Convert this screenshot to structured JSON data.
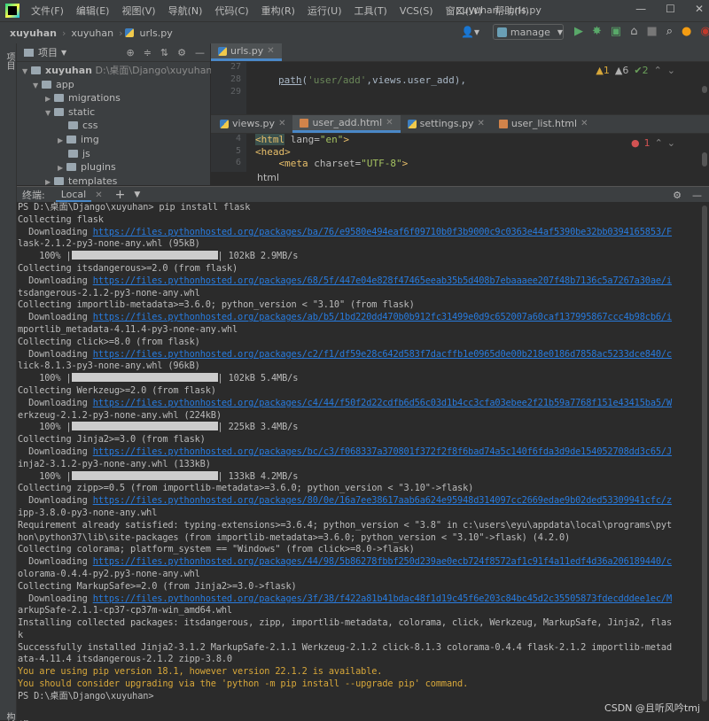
{
  "menubar": {
    "items": [
      "文件(F)",
      "编辑(E)",
      "视图(V)",
      "导航(N)",
      "代码(C)",
      "重构(R)",
      "运行(U)",
      "工具(T)",
      "VCS(S)",
      "窗口(W)",
      "帮助(H)"
    ],
    "window_title": "xuyuhan - urls.py",
    "window_buttons": [
      "—",
      "☐",
      "✕"
    ]
  },
  "navbar": {
    "crumbs": [
      "xuyuhan",
      "xuyuhan",
      "urls.py"
    ],
    "run_config": "manage"
  },
  "left_strip": {
    "top_label": "项目",
    "bottom_label": "结构"
  },
  "project": {
    "header": "项目",
    "tree": [
      {
        "label": "xuyuhan",
        "path": "D:\\桌面\\Django\\xuyuhan",
        "level": 1,
        "open": true
      },
      {
        "label": "app",
        "level": 2,
        "open": true
      },
      {
        "label": "migrations",
        "level": 3,
        "open": false
      },
      {
        "label": "static",
        "level": 3,
        "open": true
      },
      {
        "label": "css",
        "level": 4,
        "open": false
      },
      {
        "label": "img",
        "level": 4,
        "open": false
      },
      {
        "label": "js",
        "level": 4,
        "open": false
      },
      {
        "label": "plugins",
        "level": 4,
        "open": false
      },
      {
        "label": "templates",
        "level": 3,
        "open": false
      }
    ]
  },
  "editor1": {
    "tab": "urls.py",
    "line_numbers": [
      "27",
      "28",
      "29"
    ],
    "code_path": "path",
    "code_str": "'user/add'",
    "code_rest": ",views.user_add),",
    "inspections": {
      "warnings": "1",
      "weak": "6",
      "ok": "2"
    }
  },
  "editor2": {
    "tabs": [
      "views.py",
      "user_add.html",
      "settings.py",
      "user_list.html"
    ],
    "active_tab": 1,
    "line_numbers": [
      "4",
      "5",
      "6"
    ],
    "line1_tag": "<html",
    "line1_attr": " lang=",
    "line1_val": "\"en\"",
    "line1_end": ">",
    "line2": "<head>",
    "line3_tag": "<meta",
    "line3_attr": " charset=",
    "line3_val": "\"UTF-8\"",
    "line3_end": ">",
    "breadcrumb": "html",
    "errors": "1"
  },
  "terminal": {
    "label": "终端:",
    "tab": "Local",
    "lines": [
      {
        "t": "PS D:\\桌面\\Django\\xuyuhan> pip install flask"
      },
      {
        "t": "Collecting flask"
      },
      {
        "t": "  Downloading ",
        "l": "https://files.pythonhosted.org/packages/ba/76/e9580e494eaf6f09710b0f3b9000c9c0363e44af5390be32bb0394165853/F"
      },
      {
        "t": "lask-2.1.2-py3-none-any.whl (95kB)"
      },
      {
        "t": "    100% |",
        "bar": 165,
        "a": "| 102kB 2.9MB/s"
      },
      {
        "t": "Collecting itsdangerous>=2.0 (from flask)"
      },
      {
        "t": "  Downloading ",
        "l": "https://files.pythonhosted.org/packages/68/5f/447e04e828f47465eeab35b5d408b7ebaaaee207f48b7136c5a7267a30ae/i"
      },
      {
        "t": "tsdangerous-2.1.2-py3-none-any.whl"
      },
      {
        "t": "Collecting importlib-metadata>=3.6.0; python_version < \"3.10\" (from flask)"
      },
      {
        "t": "  Downloading ",
        "l": "https://files.pythonhosted.org/packages/ab/b5/1bd220dd470b0b912fc31499e0d9c652007a60caf137995867ccc4b98cb6/i"
      },
      {
        "t": "mportlib_metadata-4.11.4-py3-none-any.whl"
      },
      {
        "t": "Collecting click>=8.0 (from flask)"
      },
      {
        "t": "  Downloading ",
        "l": "https://files.pythonhosted.org/packages/c2/f1/df59e28c642d583f7dacffb1e0965d0e00b218e0186d7858ac5233dce840/c"
      },
      {
        "t": "lick-8.1.3-py3-none-any.whl (96kB)"
      },
      {
        "t": "    100% |",
        "bar": 165,
        "a": "| 102kB 5.4MB/s"
      },
      {
        "t": "Collecting Werkzeug>=2.0 (from flask)"
      },
      {
        "t": "  Downloading ",
        "l": "https://files.pythonhosted.org/packages/c4/44/f50f2d22cdfb6d56c03d1b4cc3cfa03ebee2f21b59a7768f151e43415ba5/W"
      },
      {
        "t": "erkzeug-2.1.2-py3-none-any.whl (224kB)"
      },
      {
        "t": "    100% |",
        "bar": 165,
        "a": "| 225kB 3.4MB/s"
      },
      {
        "t": "Collecting Jinja2>=3.0 (from flask)"
      },
      {
        "t": "  Downloading ",
        "l": "https://files.pythonhosted.org/packages/bc/c3/f068337a370801f372f2f8f6bad74a5c140f6fda3d9de154052708dd3c65/J"
      },
      {
        "t": "inja2-3.1.2-py3-none-any.whl (133kB)"
      },
      {
        "t": "    100% |",
        "bar": 165,
        "a": "| 133kB 4.2MB/s"
      },
      {
        "t": "Collecting zipp>=0.5 (from importlib-metadata>=3.6.0; python_version < \"3.10\"->flask)"
      },
      {
        "t": "  Downloading ",
        "l": "https://files.pythonhosted.org/packages/80/0e/16a7ee38617aab6a624e95948d314097cc2669edae9b02ded53309941cfc/z"
      },
      {
        "t": "ipp-3.8.0-py3-none-any.whl"
      },
      {
        "t": "Requirement already satisfied: typing-extensions>=3.6.4; python_version < \"3.8\" in c:\\users\\eyu\\appdata\\local\\programs\\pyt"
      },
      {
        "t": "hon\\python37\\lib\\site-packages (from importlib-metadata>=3.6.0; python_version < \"3.10\"->flask) (4.2.0)"
      },
      {
        "t": "Collecting colorama; platform_system == \"Windows\" (from click>=8.0->flask)"
      },
      {
        "t": "  Downloading ",
        "l": "https://files.pythonhosted.org/packages/44/98/5b86278fbbf250d239ae0ecb724f8572af1c91f4a11edf4d36a206189440/c"
      },
      {
        "t": "olorama-0.4.4-py2.py3-none-any.whl"
      },
      {
        "t": "Collecting MarkupSafe>=2.0 (from Jinja2>=3.0->flask)"
      },
      {
        "t": "  Downloading ",
        "l": "https://files.pythonhosted.org/packages/3f/38/f422a81b41bdac48f1d19c45f6e203c84bc45d2c35505873fdecdddee1ec/M"
      },
      {
        "t": "arkupSafe-2.1.1-cp37-cp37m-win_amd64.whl"
      },
      {
        "t": "Installing collected packages: itsdangerous, zipp, importlib-metadata, colorama, click, Werkzeug, MarkupSafe, Jinja2, flas"
      },
      {
        "t": "k"
      },
      {
        "t": "Successfully installed Jinja2-3.1.2 MarkupSafe-2.1.1 Werkzeug-2.1.2 click-8.1.3 colorama-0.4.4 flask-2.1.2 importlib-metad"
      },
      {
        "t": "ata-4.11.4 itsdangerous-2.1.2 zipp-3.8.0"
      },
      {
        "t": "You are using pip version 18.1, however version 22.1.2 is available.",
        "w": true
      },
      {
        "t": "You should consider upgrading via the 'python -m pip install --upgrade pip' command.",
        "w": true
      },
      {
        "t": "PS D:\\桌面\\Django\\xuyuhan>"
      }
    ]
  },
  "watermark": "CSDN @且听风吟tmj"
}
